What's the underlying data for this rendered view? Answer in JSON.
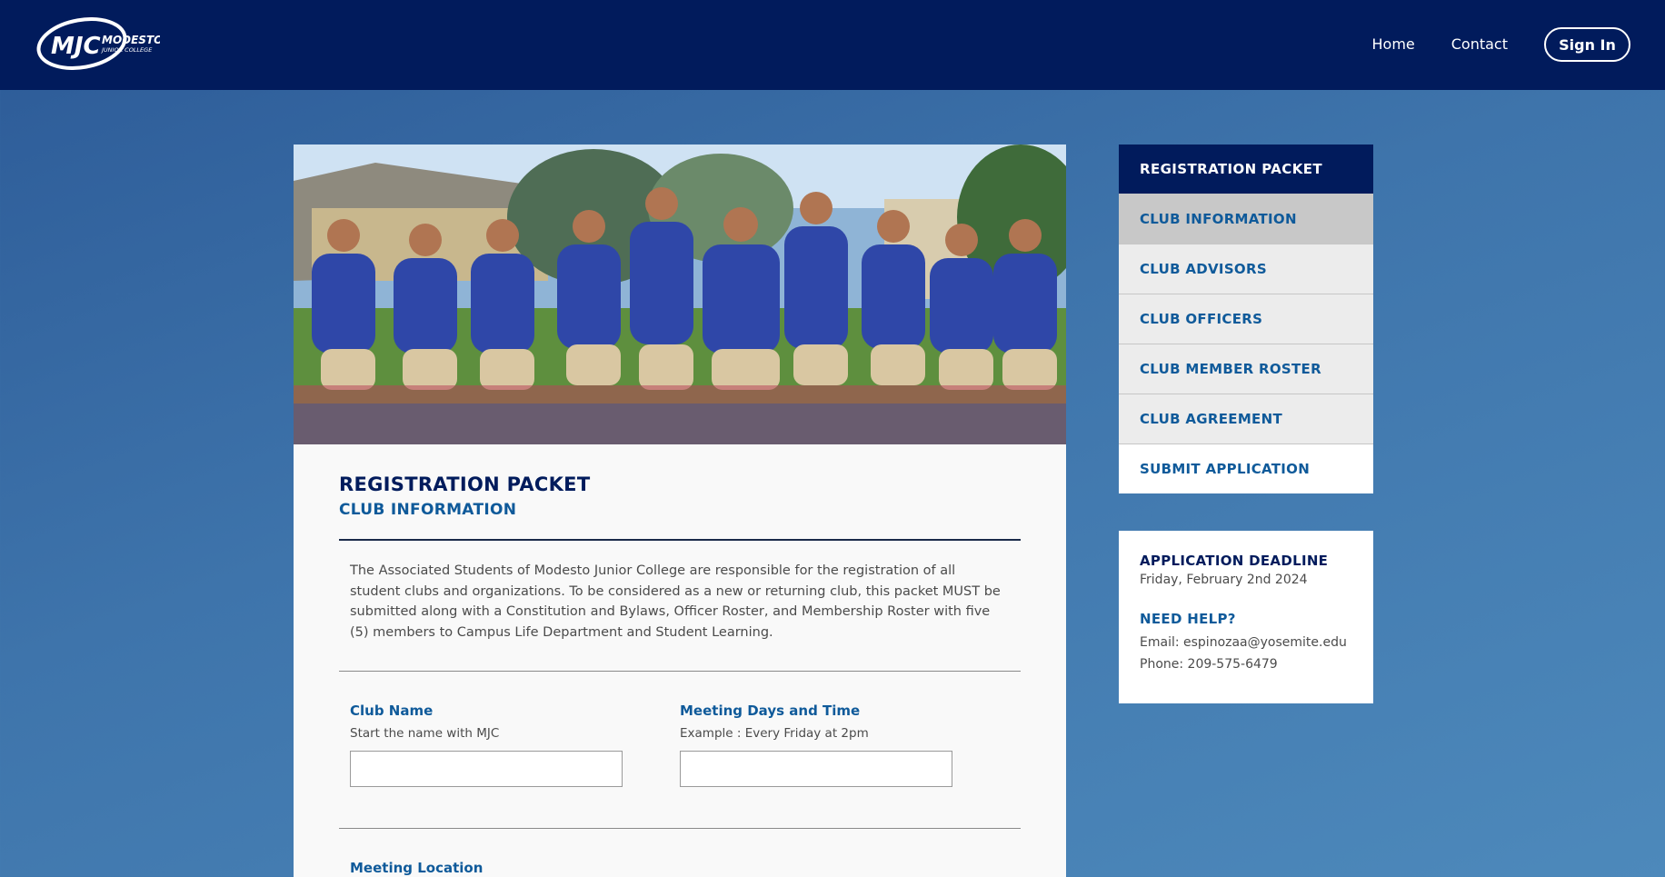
{
  "header": {
    "logo_text": "MJC",
    "logo_name": "MODESTO",
    "logo_sub": "JUNIOR COLLEGE",
    "nav": [
      "Home",
      "Contact"
    ],
    "signin_label": "Sign In"
  },
  "main": {
    "hero_image": "student-club-group-photo",
    "title": "REGISTRATION PACKET",
    "subtitle": "CLUB INFORMATION",
    "intro": "The Associated Students of Modesto Junior College are responsible for the registration of all student clubs and organizations. To be considered as a new or returning club, this packet MUST be submitted along with a Constitution and Bylaws, Officer Roster, and Membership Roster with five (5) members to Campus Life Department and Student Learning.",
    "fields": [
      {
        "label": "Club Name",
        "hint": "Start the name with MJC",
        "value": ""
      },
      {
        "label": "Meeting Days and Time",
        "hint": "Example : Every Friday at 2pm",
        "value": ""
      }
    ],
    "next_field_label": "Meeting Location"
  },
  "sidebar": {
    "heading": "REGISTRATION PACKET",
    "items": [
      {
        "label": "CLUB INFORMATION"
      },
      {
        "label": "CLUB ADVISORS"
      },
      {
        "label": "CLUB OFFICERS"
      },
      {
        "label": "CLUB MEMBER ROSTER"
      },
      {
        "label": "CLUB AGREEMENT"
      },
      {
        "label": "SUBMIT APPLICATION"
      }
    ],
    "active_index": 0
  },
  "info": {
    "deadline_title": "APPLICATION DEADLINE",
    "deadline_date": "Friday, February 2nd 2024",
    "help_title": "NEED HELP?",
    "email": "Email: espinozaa@yosemite.edu",
    "phone": "Phone: 209-575-6479"
  },
  "colors": {
    "header_bg": "#011b5c",
    "accent_blue": "#0f5a9a",
    "active_item": "#c8c8c8"
  }
}
